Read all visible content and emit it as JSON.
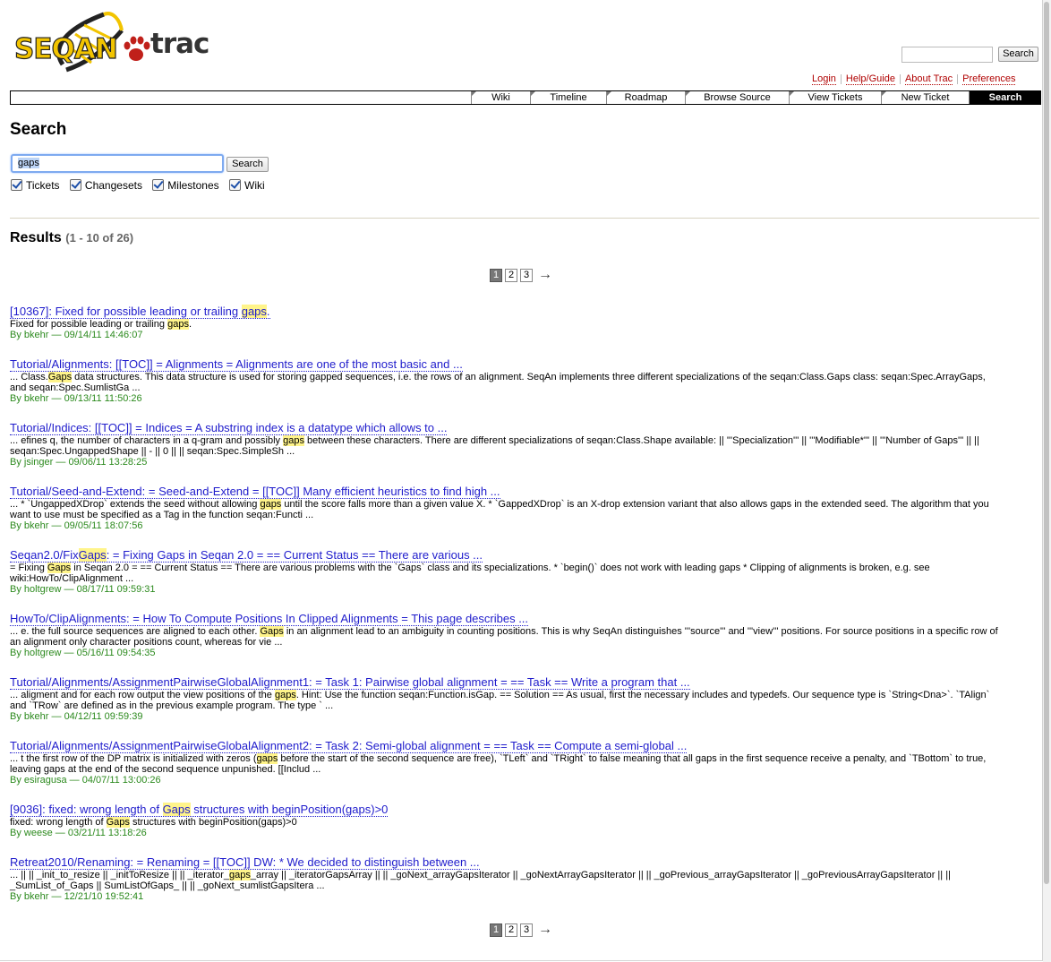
{
  "logo": {
    "seqan": "SEQAN",
    "trac": "trac"
  },
  "top_search": {
    "button": "Search"
  },
  "metanav": [
    "Login",
    "Help/Guide",
    "About Trac",
    "Preferences"
  ],
  "mainnav": [
    "Wiki",
    "Timeline",
    "Roadmap",
    "Browse Source",
    "View Tickets",
    "New Ticket",
    "Search"
  ],
  "page": {
    "title": "Search",
    "query": "gaps",
    "search_button": "Search",
    "filters": [
      "Tickets",
      "Changesets",
      "Milestones",
      "Wiki"
    ],
    "results_label": "Results",
    "results_range": "(1 - 10 of 26)"
  },
  "pager": {
    "pages": [
      "1",
      "2",
      "3"
    ],
    "current": "1",
    "next": "→"
  },
  "results": [
    {
      "title": [
        "[10367]: Fixed for possible leading or trailing ",
        "gaps",
        "."
      ],
      "excerpt": [
        "Fixed for possible leading or trailing ",
        "gaps",
        "."
      ],
      "author": "bkehr",
      "date": "09/14/11 14:46:07"
    },
    {
      "title": [
        "Tutorial/Alignments: [[TOC]] = Alignments = Alignments are one of the most basic and ...",
        "",
        ""
      ],
      "excerpt": [
        "... Class.",
        "Gaps",
        " data structures. This data structure is used for storing gapped sequences, i.e. the rows of an alignment. SeqAn implements three different specializations of the seqan:Class.Gaps class: seqan:Spec.ArrayGaps, and seqan:Spec.SumlistGa ..."
      ],
      "author": "bkehr",
      "date": "09/13/11 11:50:26"
    },
    {
      "title": [
        "Tutorial/Indices: [[TOC]] = Indices = A substring index is a datatype which allows to ...",
        "",
        ""
      ],
      "excerpt": [
        "... efines q, the number of characters in a q-gram and possibly ",
        "gaps",
        " between these characters. There are different specializations of seqan:Class.Shape available: || '''Specialization''' || '''Modifiable*''' || '''Number of Gaps''' || || seqan:Spec.UngappedShape || - || 0 || || seqan:Spec.SimpleSh ..."
      ],
      "author": "jsinger",
      "date": "09/06/11 13:28:25"
    },
    {
      "title": [
        "Tutorial/Seed-and-Extend: = Seed-and-Extend = [[TOC]] Many efficient heuristics to find high ...",
        "",
        ""
      ],
      "excerpt": [
        "... * `UngappedXDrop` extends the seed without allowing ",
        "gaps",
        " until the score falls more than a given value X. * `GappedXDrop` is an X-drop extension variant that also allows gaps in the extended seed. The algorithm that you want to use must be specified as a Tag in the function seqan:Functi ..."
      ],
      "author": "bkehr",
      "date": "09/05/11 18:07:56"
    },
    {
      "title": [
        "Seqan2.0/Fix",
        "Gaps",
        ": = Fixing Gaps in Seqan 2.0 = == Current Status == There are various ..."
      ],
      "excerpt": [
        "= Fixing ",
        "Gaps",
        " in Seqan 2.0 = == Current Status == There are various problems with the `Gaps` class and its specializations. * `begin()` does not work with leading gaps * Clipping of alignments is broken, e.g. see wiki:HowTo/ClipAlignment ..."
      ],
      "author": "holtgrew",
      "date": "08/17/11 09:59:31"
    },
    {
      "title": [
        "HowTo/ClipAlignments: = How To Compute Positions In Clipped Alignments = This page describes ...",
        "",
        ""
      ],
      "excerpt": [
        "... e. the full source sequences are aligned to each other. ",
        "Gaps",
        " in an alignment lead to an ambiguity in counting positions. This is why SeqAn distinguishes '''source''' and '''view''' positions. For source positions in a specific row of an alignment only character positions count, whereas for vie ..."
      ],
      "author": "holtgrew",
      "date": "05/16/11 09:54:35"
    },
    {
      "title": [
        "Tutorial/Alignments/AssignmentPairwiseGlobalAlignment1: = Task 1: Pairwise global alignment = == Task == Write a program that ...",
        "",
        ""
      ],
      "excerpt": [
        "... aligment and for each row output the view positions of the ",
        "gaps",
        ". Hint: Use the function seqan:Function.isGap. == Solution == As usual, first the necessary includes and typedefs. Our sequence type is `String<Dna>`. `TAlign` and `TRow` are defined as in the previous example program. The type ` ..."
      ],
      "author": "bkehr",
      "date": "04/12/11 09:59:39"
    },
    {
      "title": [
        "Tutorial/Alignments/AssignmentPairwiseGlobalAlignment2: = Task 2: Semi-global alignment = == Task == Compute a semi-global ...",
        "",
        ""
      ],
      "excerpt": [
        "... t the first row of the DP matrix is initialized with zeros (",
        "gaps",
        " before the start of the second sequence are free), `TLeft` and `TRight` to false meaning that all gaps in the first sequence receive a penalty, and `TBottom` to true, leaving gaps at the end of the second sequence unpunished. [[Includ ..."
      ],
      "author": "esiragusa",
      "date": "04/07/11 13:00:26"
    },
    {
      "title": [
        "[9036]: fixed: wrong length of ",
        "Gaps",
        " structures with beginPosition(gaps)>0"
      ],
      "excerpt": [
        "fixed: wrong length of ",
        "Gaps",
        " structures with beginPosition(gaps)>0"
      ],
      "author": "weese",
      "date": "03/21/11 13:18:26"
    },
    {
      "title": [
        "Retreat2010/Renaming: = Renaming = [[TOC]] DW: * We decided to distinguish between ...",
        "",
        ""
      ],
      "excerpt": [
        "... || || _init_to_resize || _initToResize || || _iterator_",
        "gaps",
        "_array || _iteratorGapsArray || || _goNext_arrayGapsIterator || _goNextArrayGapsIterator || || _goPrevious_arrayGapsIterator || _goPreviousArrayGapsIterator || || _SumList_of_Gaps || SumListOfGaps_ || || _goNext_sumlistGapsItera ..."
      ],
      "author": "bkehr",
      "date": "12/21/10 19:52:41"
    }
  ]
}
